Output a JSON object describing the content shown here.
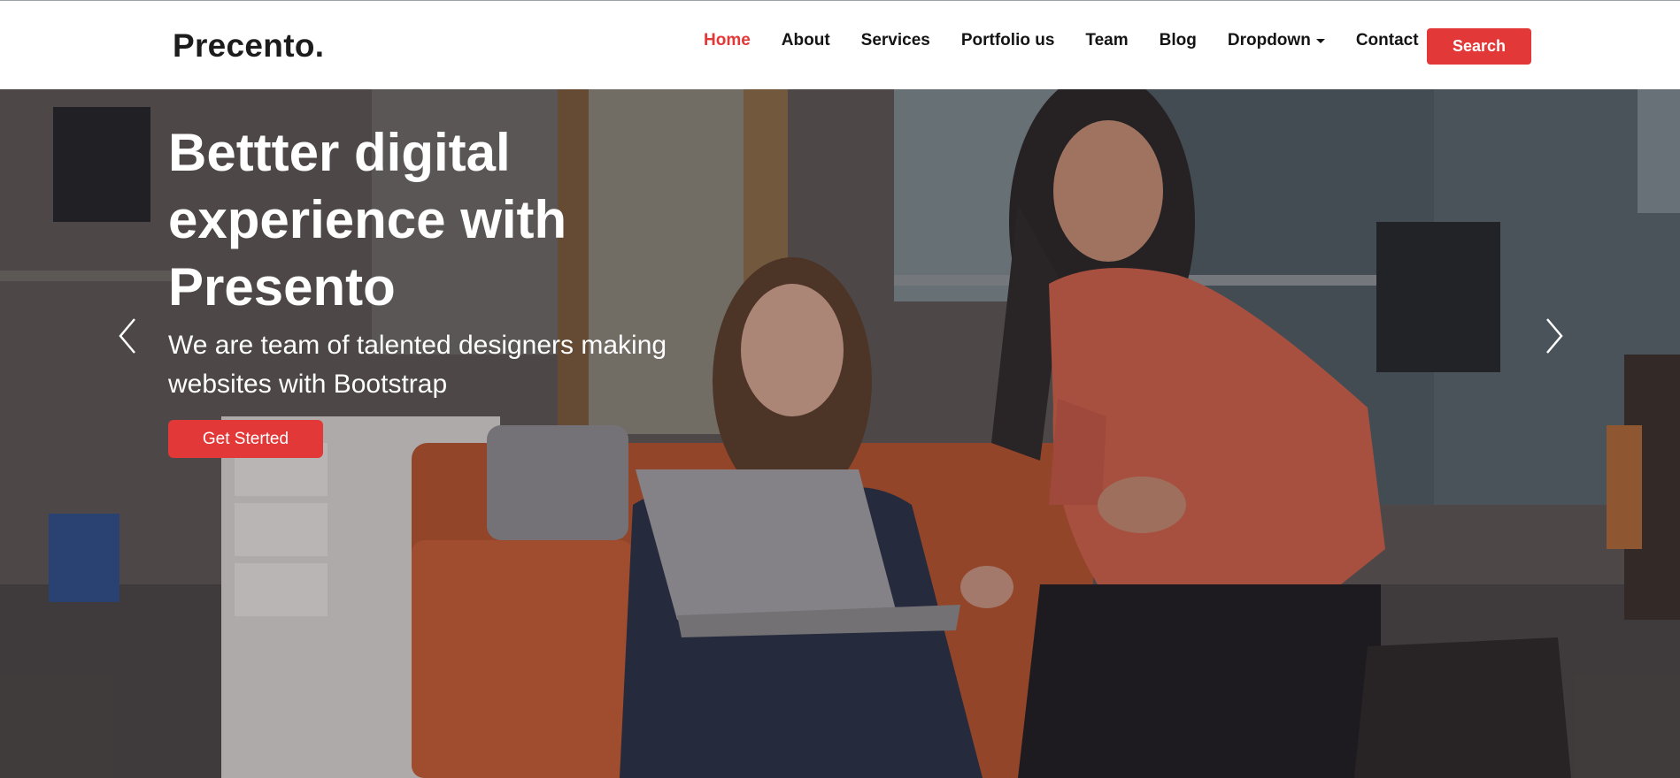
{
  "navbar": {
    "brand": "Precento.",
    "links": [
      "Home",
      "About",
      "Services",
      "Portfolio us",
      "Team",
      "Blog",
      "Dropdown",
      "Contact"
    ],
    "active": "Home",
    "dropdown_icon": "caret-down-icon",
    "search_label": "Search"
  },
  "hero": {
    "title": "Bettter digital experience with Presento",
    "subtitle": "We are team of talented designers making websites with Bootstrap",
    "cta_label": "Get Sterted",
    "prev_icon": "chevron-left-icon",
    "next_icon": "chevron-right-icon"
  },
  "colors": {
    "accent": "#e23838",
    "text_dark": "#141414",
    "hero_text": "#ffffff"
  }
}
